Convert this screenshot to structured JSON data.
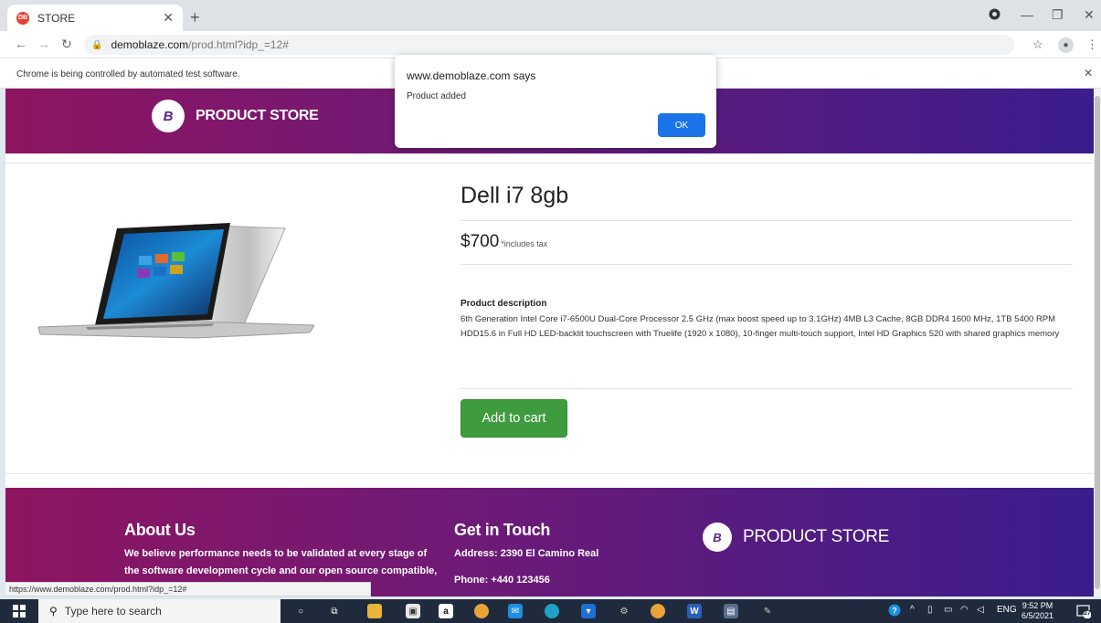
{
  "browser": {
    "tab_title": "STORE",
    "tab_favicon_text": "DB",
    "url_host": "demoblaze.com",
    "url_path": "/prod.html?idp_=12#",
    "infobar_message": "Chrome is being controlled by automated test software.",
    "status_url": "https://www.demoblaze.com/prod.html?idp_=12#"
  },
  "site": {
    "brand_logo_text": "B",
    "brand_name": "PRODUCT STORE"
  },
  "product": {
    "name": "Dell i7 8gb",
    "price": "$700",
    "tax_note": "*includes tax",
    "description_label": "Product description",
    "description": "6th Generation Intel Core i7-6500U Dual-Core Processor 2.5 GHz (max boost speed up to 3.1GHz) 4MB L3 Cache, 8GB DDR4 1600 MHz, 1TB 5400 RPM HDD15.6 in Full HD LED-backlit touchscreen with Truelife (1920 x 1080), 10-finger multi-touch support, Intel HD Graphics 520 with shared graphics memory",
    "add_to_cart_label": "Add to cart"
  },
  "footer": {
    "about_title": "About Us",
    "about_line1": "We believe performance needs to be validated at every stage of",
    "about_line2": "the software development cycle and our open source compatible,",
    "contact_title": "Get in Touch",
    "address": "Address: 2390 El Camino Real",
    "phone": "Phone: +440 123456",
    "brand_name": "PRODUCT STORE"
  },
  "dialog": {
    "title": "www.demoblaze.com says",
    "message": "Product added",
    "ok_label": "OK"
  },
  "taskbar": {
    "search_placeholder": "Type here to search",
    "language": "ENG",
    "time": "9:52 PM",
    "date": "6/5/2021",
    "notification_count": "27"
  },
  "colors": {
    "header_gradient_start": "#8e1561",
    "header_gradient_end": "#3a1d8c",
    "add_to_cart": "#3e9c3e",
    "dialog_ok": "#1a73e8"
  }
}
